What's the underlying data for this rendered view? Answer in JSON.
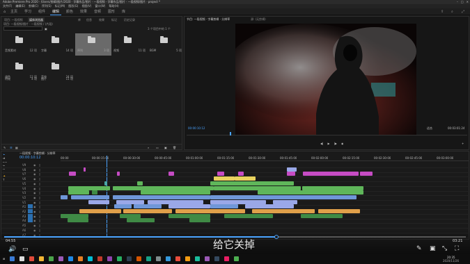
{
  "window": {
    "title": "Adobe Premiere Pro 2020 - /Users/剪辑/图片/2020 · 字幕作品/图片 · 一段视频 - 字幕作品/图片 · 一段视频/图片 · project *",
    "menu": [
      "文件(F)",
      "编辑(E)",
      "剪辑(C)",
      "序列(S)",
      "标记(M)",
      "图形(G)",
      "视图(V)",
      "窗口(W)",
      "帮助(H)"
    ]
  },
  "workspace": {
    "tabs": [
      "主页",
      "学习",
      "组件",
      "编辑",
      "颜色",
      "效果",
      "音频",
      "图形",
      "库"
    ]
  },
  "project": {
    "tabs": [
      "项目: 一段视频",
      "媒体浏览器",
      "库",
      "信息",
      "效果",
      "标记",
      "历史记录"
    ],
    "path": "项目: 一段视频/图片 · 一段视频 / (片段)",
    "search_placeholder": "",
    "item_count": "3 个项目中的 1 个",
    "bins": [
      {
        "label": "音频素材",
        "count": "12 项"
      },
      {
        "label": "字幕",
        "count": "14 项"
      },
      {
        "label": "序列",
        "count": "3 项"
      },
      {
        "label": "视频",
        "count": "11 项"
      },
      {
        "label": "BGM",
        "count": "5 项"
      },
      {
        "label": "调色",
        "count": "12 项"
      },
      {
        "label": "音效",
        "count": "24 项"
      },
      {
        "label": "特效",
        "count": "4 项"
      },
      {
        "label": "图片",
        "count": "11 项"
      }
    ]
  },
  "monitor": {
    "tab": "节目: 一段视频 · 字幕剪辑 · 分辨率",
    "source_tab": "源: (无剪辑)",
    "timecode": "00:00:10:12",
    "fit": "适合",
    "duration": "00:03:01:24",
    "quality": "完整"
  },
  "timeline": {
    "tab": "一段视频 · 字幕剪辑 · 分辨率",
    "timecode": "00:00:10:12",
    "ruler": [
      "00:00",
      "00:00:15:00",
      "00:00:30:00",
      "00:00:45:00",
      "00:01:00:00",
      "00:01:15:00",
      "00:01:30:00",
      "00:01:45:00",
      "00:02:00:00",
      "00:02:15:00",
      "00:02:30:00",
      "00:02:45:00",
      "00:03:00:00"
    ],
    "tracks": [
      "V9",
      "V8",
      "V7",
      "V6",
      "V5",
      "V4",
      "V3",
      "V2",
      "V1",
      "A1",
      "A2",
      "A3",
      "A4",
      "A5",
      "A6",
      "A7"
    ]
  },
  "player": {
    "time_elapsed": "04:55",
    "time_total": "03:21",
    "progress": 0.59,
    "subtitle": "给它关掉"
  },
  "taskbar": {
    "time": "20:35",
    "date": "2020/11/26"
  },
  "colors": {
    "accent": "#4aa3ff",
    "clip_green": "#5fb65a",
    "clip_pink": "#c64cc4",
    "clip_blue": "#6f97d8",
    "clip_orange": "#e0a04a"
  }
}
